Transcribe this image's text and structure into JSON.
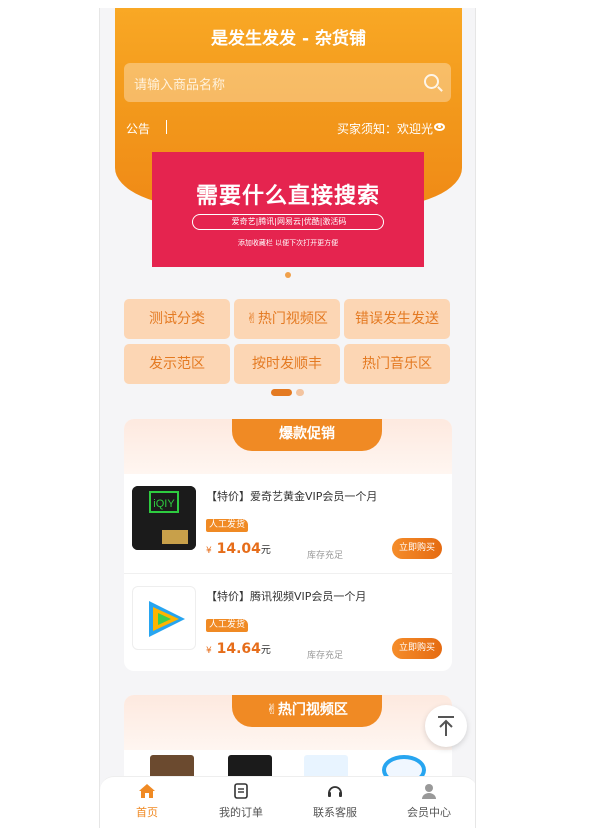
{
  "header": {
    "title": "是发生发发 - 杂货铺",
    "search_placeholder": "请输入商品名称",
    "notice_label": "公告",
    "buyer_notice": "买家须知：欢迎光"
  },
  "banner": {
    "title": "需要什么直接搜索",
    "subtitle": "爱奇艺|腾讯|网易云|优酷|激活码",
    "note": "添加收藏栏 以便下次打开更方便"
  },
  "categories": [
    "测试分类",
    "✌热门视频区",
    "错误发生发送",
    "发示范区",
    "按时发顺丰",
    "热门音乐区"
  ],
  "promo": {
    "title": "爆款促销",
    "items": [
      {
        "name": "【特价】爱奇艺黄金VIP会员一个月",
        "tag": "人工发货",
        "currency": "¥",
        "price": "14.04",
        "unit": "元",
        "stock": "库存充足",
        "buy_label": "立即购买"
      },
      {
        "name": "【特价】腾讯视频VIP会员一个月",
        "tag": "人工发货",
        "currency": "¥",
        "price": "14.64",
        "unit": "元",
        "stock": "库存充足",
        "buy_label": "立即购买"
      }
    ]
  },
  "video_section": {
    "title": "✌热门视频区"
  },
  "tabbar": {
    "items": [
      {
        "label": "首页",
        "icon": "home-icon"
      },
      {
        "label": "我的订单",
        "icon": "order-icon"
      },
      {
        "label": "联系客服",
        "icon": "headset-icon"
      },
      {
        "label": "会员中心",
        "icon": "user-icon"
      }
    ]
  },
  "colors": {
    "accent": "#f08a24",
    "banner": "#e5244f",
    "active_tab": "#f08a24"
  }
}
